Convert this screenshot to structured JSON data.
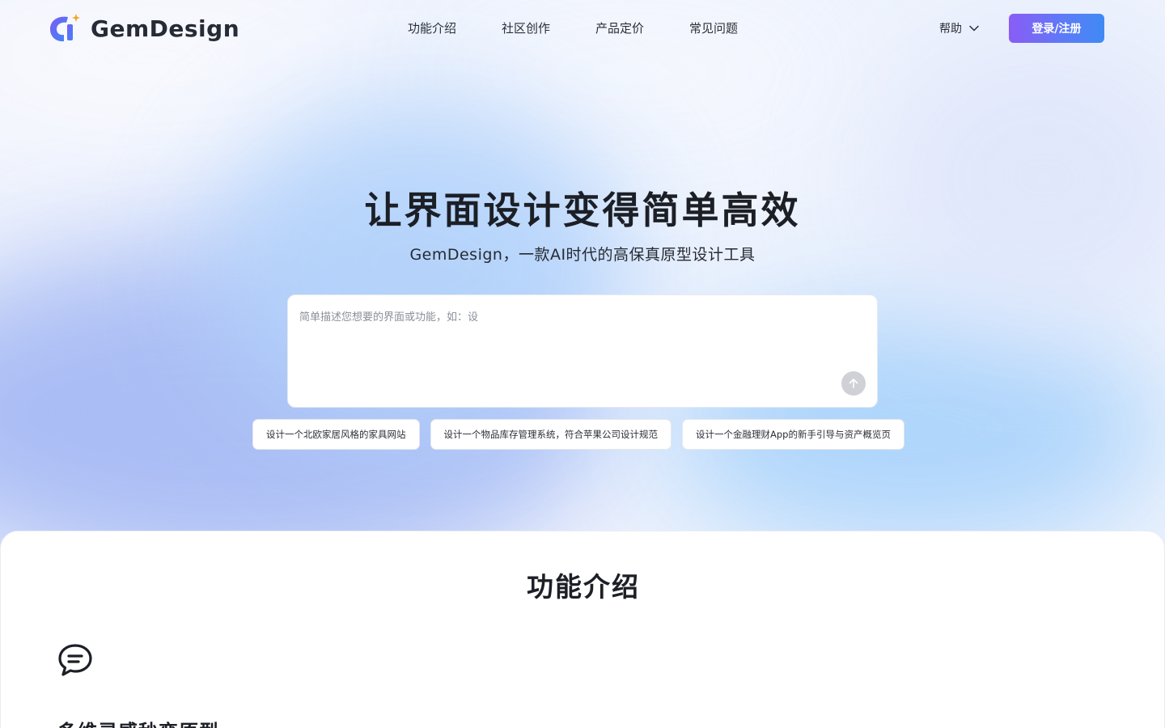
{
  "header": {
    "brand_name": "GemDesign",
    "nav": [
      {
        "label": "功能介绍"
      },
      {
        "label": "社区创作"
      },
      {
        "label": "产品定价"
      },
      {
        "label": "常见问题"
      }
    ],
    "help_label": "帮助",
    "login_label": "登录/注册"
  },
  "hero": {
    "title": "让界面设计变得简单高效",
    "subtitle": "GemDesign，一款AI时代的高保真原型设计工具",
    "prompt_placeholder": "简单描述您想要的界面或功能，如：设",
    "suggestions": [
      {
        "label": "设计一个北欧家居风格的家具网站"
      },
      {
        "label": "设计一个物品库存管理系统，符合苹果公司设计规范"
      },
      {
        "label": "设计一个金融理财App的新手引导与资产概览页"
      }
    ]
  },
  "features": {
    "title": "功能介绍",
    "first_heading": "多维灵感秒变原型"
  },
  "colors": {
    "accent_start": "#8a5cf6",
    "accent_end": "#3f8af5",
    "text_dark": "#1c1f26"
  },
  "icons": [
    "logo-icon",
    "chevron-down-icon",
    "arrow-up-icon",
    "chat-bubble-icon"
  ]
}
